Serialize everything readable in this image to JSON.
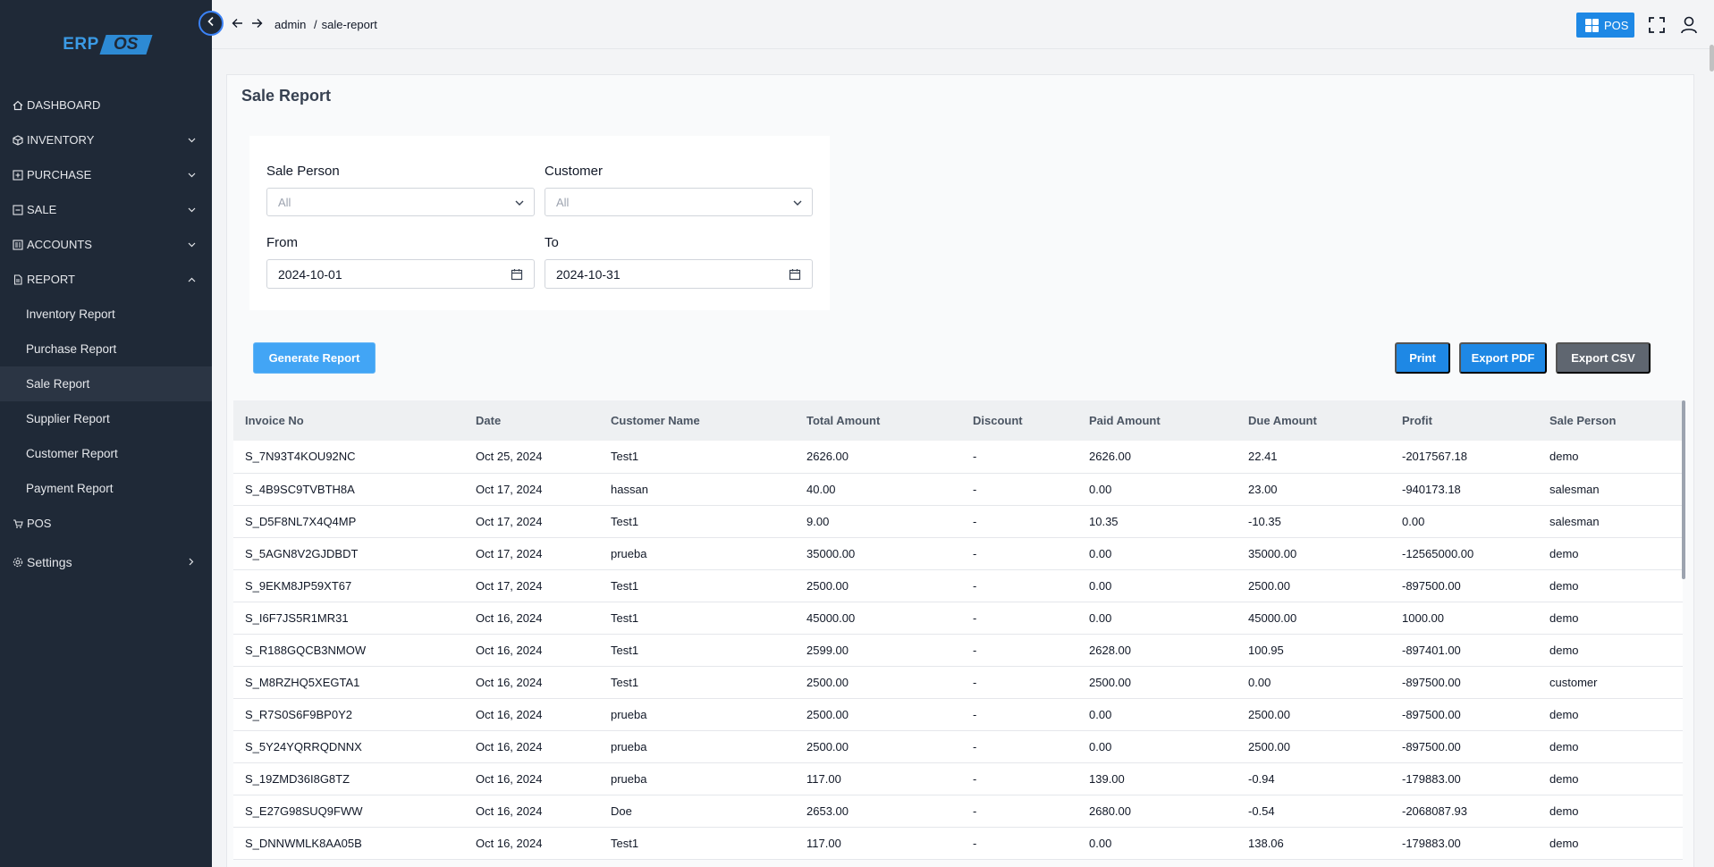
{
  "logo": {
    "text_left": "ERP",
    "text_right": "OS"
  },
  "sidebar": {
    "items": [
      {
        "label": "DASHBOARD",
        "icon": "home-icon"
      },
      {
        "label": "INVENTORY",
        "icon": "box-icon"
      },
      {
        "label": "PURCHASE",
        "icon": "plus-square-icon"
      },
      {
        "label": "SALE",
        "icon": "minus-square-icon"
      },
      {
        "label": "ACCOUNTS",
        "icon": "ledger-icon"
      },
      {
        "label": "REPORT",
        "icon": "document-icon"
      }
    ],
    "report_sub": [
      "Inventory Report",
      "Purchase Report",
      "Sale Report",
      "Supplier Report",
      "Customer Report",
      "Payment Report"
    ],
    "pos_label": "POS",
    "settings_label": "Settings"
  },
  "topbar": {
    "breadcrumb_root": "admin",
    "breadcrumb_sep": "/",
    "breadcrumb_current": "sale-report",
    "pos_label": "POS"
  },
  "page": {
    "title": "Sale Report"
  },
  "filters": {
    "sale_person_label": "Sale Person",
    "sale_person_value": "All",
    "customer_label": "Customer",
    "customer_value": "All",
    "from_label": "From",
    "from_value": "2024-10-01",
    "to_label": "To",
    "to_value": "2024-10-31"
  },
  "actions": {
    "generate": "Generate Report",
    "print": "Print",
    "export_pdf": "Export PDF",
    "export_csv": "Export CSV"
  },
  "table": {
    "headers": [
      "Invoice No",
      "Date",
      "Customer Name",
      "Total Amount",
      "Discount",
      "Paid Amount",
      "Due Amount",
      "Profit",
      "Sale Person"
    ],
    "rows": [
      [
        "S_7N93T4KOU92NC",
        "Oct 25, 2024",
        "Test1",
        "2626.00",
        "-",
        "2626.00",
        "22.41",
        "-2017567.18",
        "demo"
      ],
      [
        "S_4B9SC9TVBTH8A",
        "Oct 17, 2024",
        "hassan",
        "40.00",
        "-",
        "0.00",
        "23.00",
        "-940173.18",
        "salesman"
      ],
      [
        "S_D5F8NL7X4Q4MP",
        "Oct 17, 2024",
        "Test1",
        "9.00",
        "-",
        "10.35",
        "-10.35",
        "0.00",
        "salesman"
      ],
      [
        "S_5AGN8V2GJDBDT",
        "Oct 17, 2024",
        "prueba",
        "35000.00",
        "-",
        "0.00",
        "35000.00",
        "-12565000.00",
        "demo"
      ],
      [
        "S_9EKM8JP59XT67",
        "Oct 17, 2024",
        "Test1",
        "2500.00",
        "-",
        "0.00",
        "2500.00",
        "-897500.00",
        "demo"
      ],
      [
        "S_I6F7JS5R1MR31",
        "Oct 16, 2024",
        "Test1",
        "45000.00",
        "-",
        "0.00",
        "45000.00",
        "1000.00",
        "demo"
      ],
      [
        "S_R188GQCB3NMOW",
        "Oct 16, 2024",
        "Test1",
        "2599.00",
        "-",
        "2628.00",
        "100.95",
        "-897401.00",
        "demo"
      ],
      [
        "S_M8RZHQ5XEGTA1",
        "Oct 16, 2024",
        "Test1",
        "2500.00",
        "-",
        "2500.00",
        "0.00",
        "-897500.00",
        "customer"
      ],
      [
        "S_R7S0S6F9BP0Y2",
        "Oct 16, 2024",
        "prueba",
        "2500.00",
        "-",
        "0.00",
        "2500.00",
        "-897500.00",
        "demo"
      ],
      [
        "S_5Y24YQRRQDNNX",
        "Oct 16, 2024",
        "prueba",
        "2500.00",
        "-",
        "0.00",
        "2500.00",
        "-897500.00",
        "demo"
      ],
      [
        "S_19ZMD36I8G8TZ",
        "Oct 16, 2024",
        "prueba",
        "117.00",
        "-",
        "139.00",
        "-0.94",
        "-179883.00",
        "demo"
      ],
      [
        "S_E27G98SUQ9FWW",
        "Oct 16, 2024",
        "Doe",
        "2653.00",
        "-",
        "2680.00",
        "-0.54",
        "-2068087.93",
        "demo"
      ],
      [
        "S_DNNWMLK8AA05B",
        "Oct 16, 2024",
        "Test1",
        "117.00",
        "-",
        "0.00",
        "138.06",
        "-179883.00",
        "demo"
      ]
    ]
  },
  "colors": {
    "sidebar_bg": "#1f2937",
    "primary": "#1e88e5",
    "secondary": "#5f6670"
  }
}
